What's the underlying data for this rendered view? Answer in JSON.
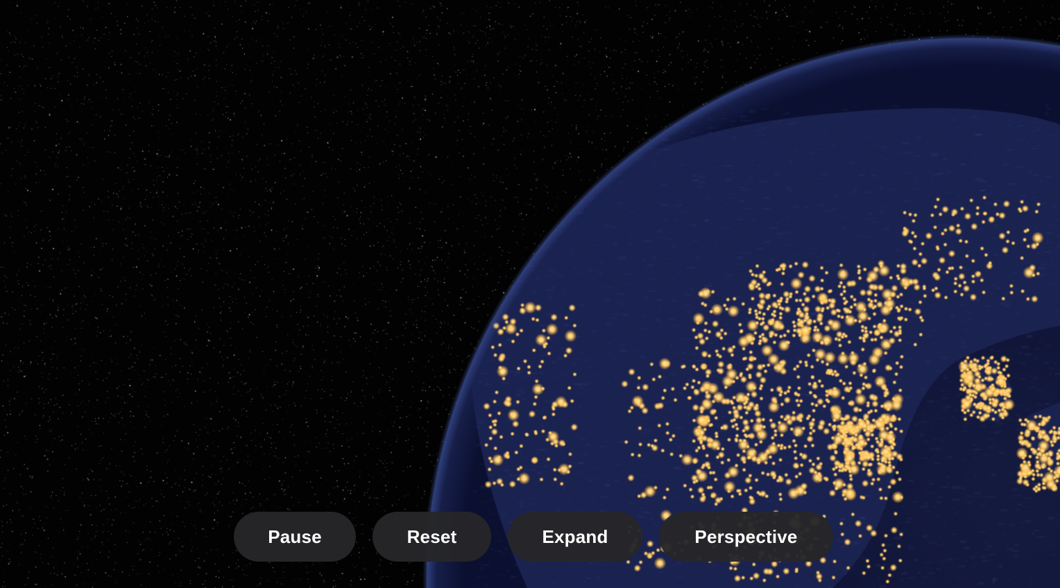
{
  "view": {
    "background_color": "#020203",
    "globe_ocean_color": "#0d1233",
    "city_light_color": "#ffcf6b"
  },
  "controls": {
    "pause_label": "Pause",
    "reset_label": "Reset",
    "expand_label": "Expand",
    "perspective_label": "Perspective"
  }
}
